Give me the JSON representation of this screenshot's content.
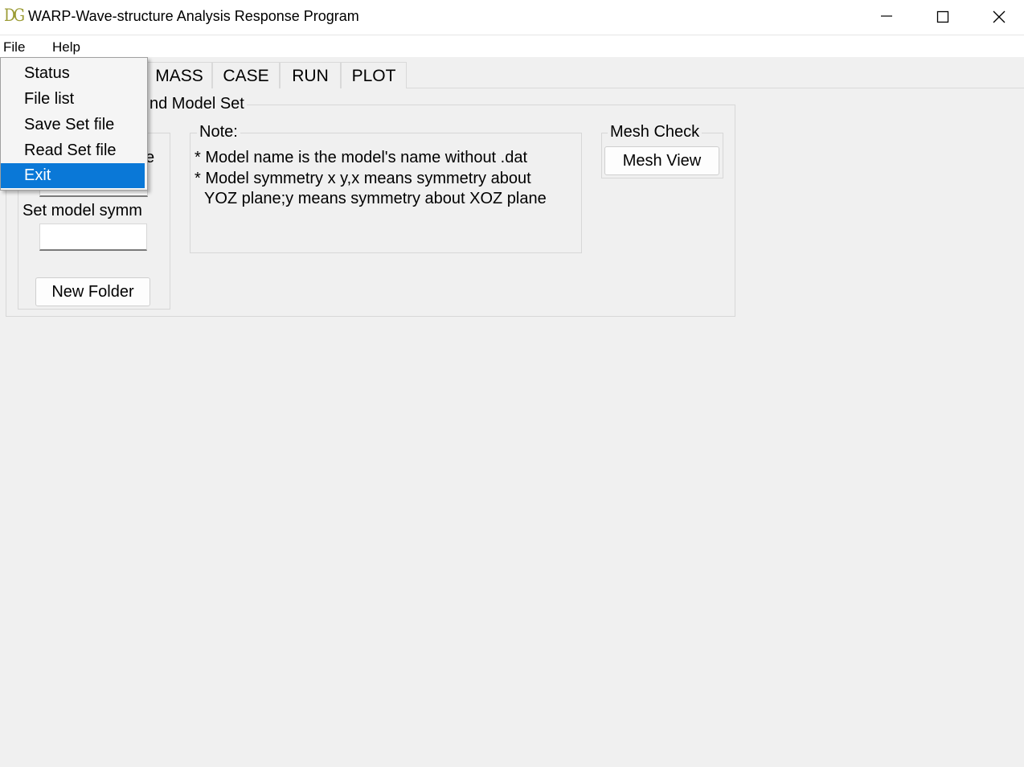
{
  "window": {
    "logo_text": "DG",
    "title": "WARP-Wave-structure Analysis Response Program"
  },
  "menubar": {
    "file": "File",
    "help": "Help"
  },
  "tabs": [
    "MASS",
    "CASE",
    "RUN",
    "PLOT"
  ],
  "main_group": {
    "legend_visible": "nd Model Set"
  },
  "left_group": {
    "partial_label_char": "e",
    "symmetry_label": "Set model symm",
    "symmetry_value": "",
    "new_folder_button": "New Folder"
  },
  "note": {
    "legend": "Note:",
    "lines": [
      "* Model name is the model's name without .dat",
      "* Model symmetry x y,x means symmetry about",
      "YOZ plane;y means symmetry about XOZ plane"
    ]
  },
  "mesh": {
    "legend": "Mesh Check",
    "button": "Mesh View"
  },
  "file_menu": {
    "items": [
      "Status",
      "File list",
      "Save Set file",
      "Read Set file",
      "Exit"
    ],
    "selected": "Exit"
  },
  "colors": {
    "selection": "#0a78d7",
    "logo": "#9b9b34",
    "background": "#f0f0f0"
  }
}
